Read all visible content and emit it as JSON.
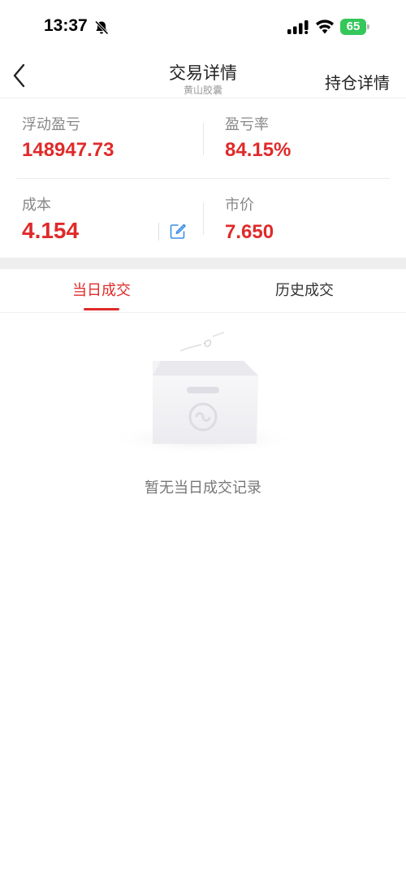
{
  "status_bar": {
    "time": "13:37",
    "battery": "65",
    "icons": [
      "bell-slash-icon",
      "signal-icon",
      "wifi-icon",
      "battery-icon"
    ],
    "battery_color": "#34c759"
  },
  "nav": {
    "back_icon": "chevron-left-icon",
    "title": "交易详情",
    "subtitle": "黄山胶囊",
    "right_link": "持仓详情"
  },
  "summary": {
    "floating_pl_label": "浮动盈亏",
    "floating_pl_value": "148947.73",
    "pl_rate_label": "盈亏率",
    "pl_rate_value": "84.15%",
    "cost_label": "成本",
    "cost_value": "4.154",
    "edit_icon": "edit-icon",
    "market_price_label": "市价",
    "market_price_value": "7.650",
    "value_color": "#e02a2a"
  },
  "tabs": [
    {
      "label": "当日成交",
      "active": true
    },
    {
      "label": "历史成交",
      "active": false
    }
  ],
  "empty_state": {
    "icon": "empty-box-icon",
    "message": "暂无当日成交记录"
  }
}
